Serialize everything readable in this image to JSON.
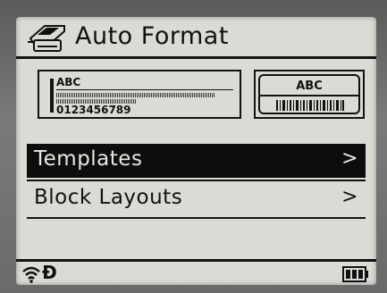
{
  "header": {
    "title": "Auto Format",
    "icon": "label-printer-icon"
  },
  "previews": {
    "left": {
      "top_text": "ABC",
      "bottom_text": "0123456789"
    },
    "right": {
      "top_text": "ABC"
    }
  },
  "menu": {
    "items": [
      {
        "label": "Templates",
        "chevron": ">",
        "selected": true
      },
      {
        "label": "Block Layouts",
        "chevron": ">",
        "selected": false
      }
    ]
  },
  "status": {
    "wifi_icon": "wifi-icon",
    "bluetooth_glyph": "Ð",
    "battery_icon": "battery-icon"
  },
  "colors": {
    "screen_bg": "#d9dcd5",
    "ink": "#111111",
    "selected_bg": "#0d0d0d"
  }
}
